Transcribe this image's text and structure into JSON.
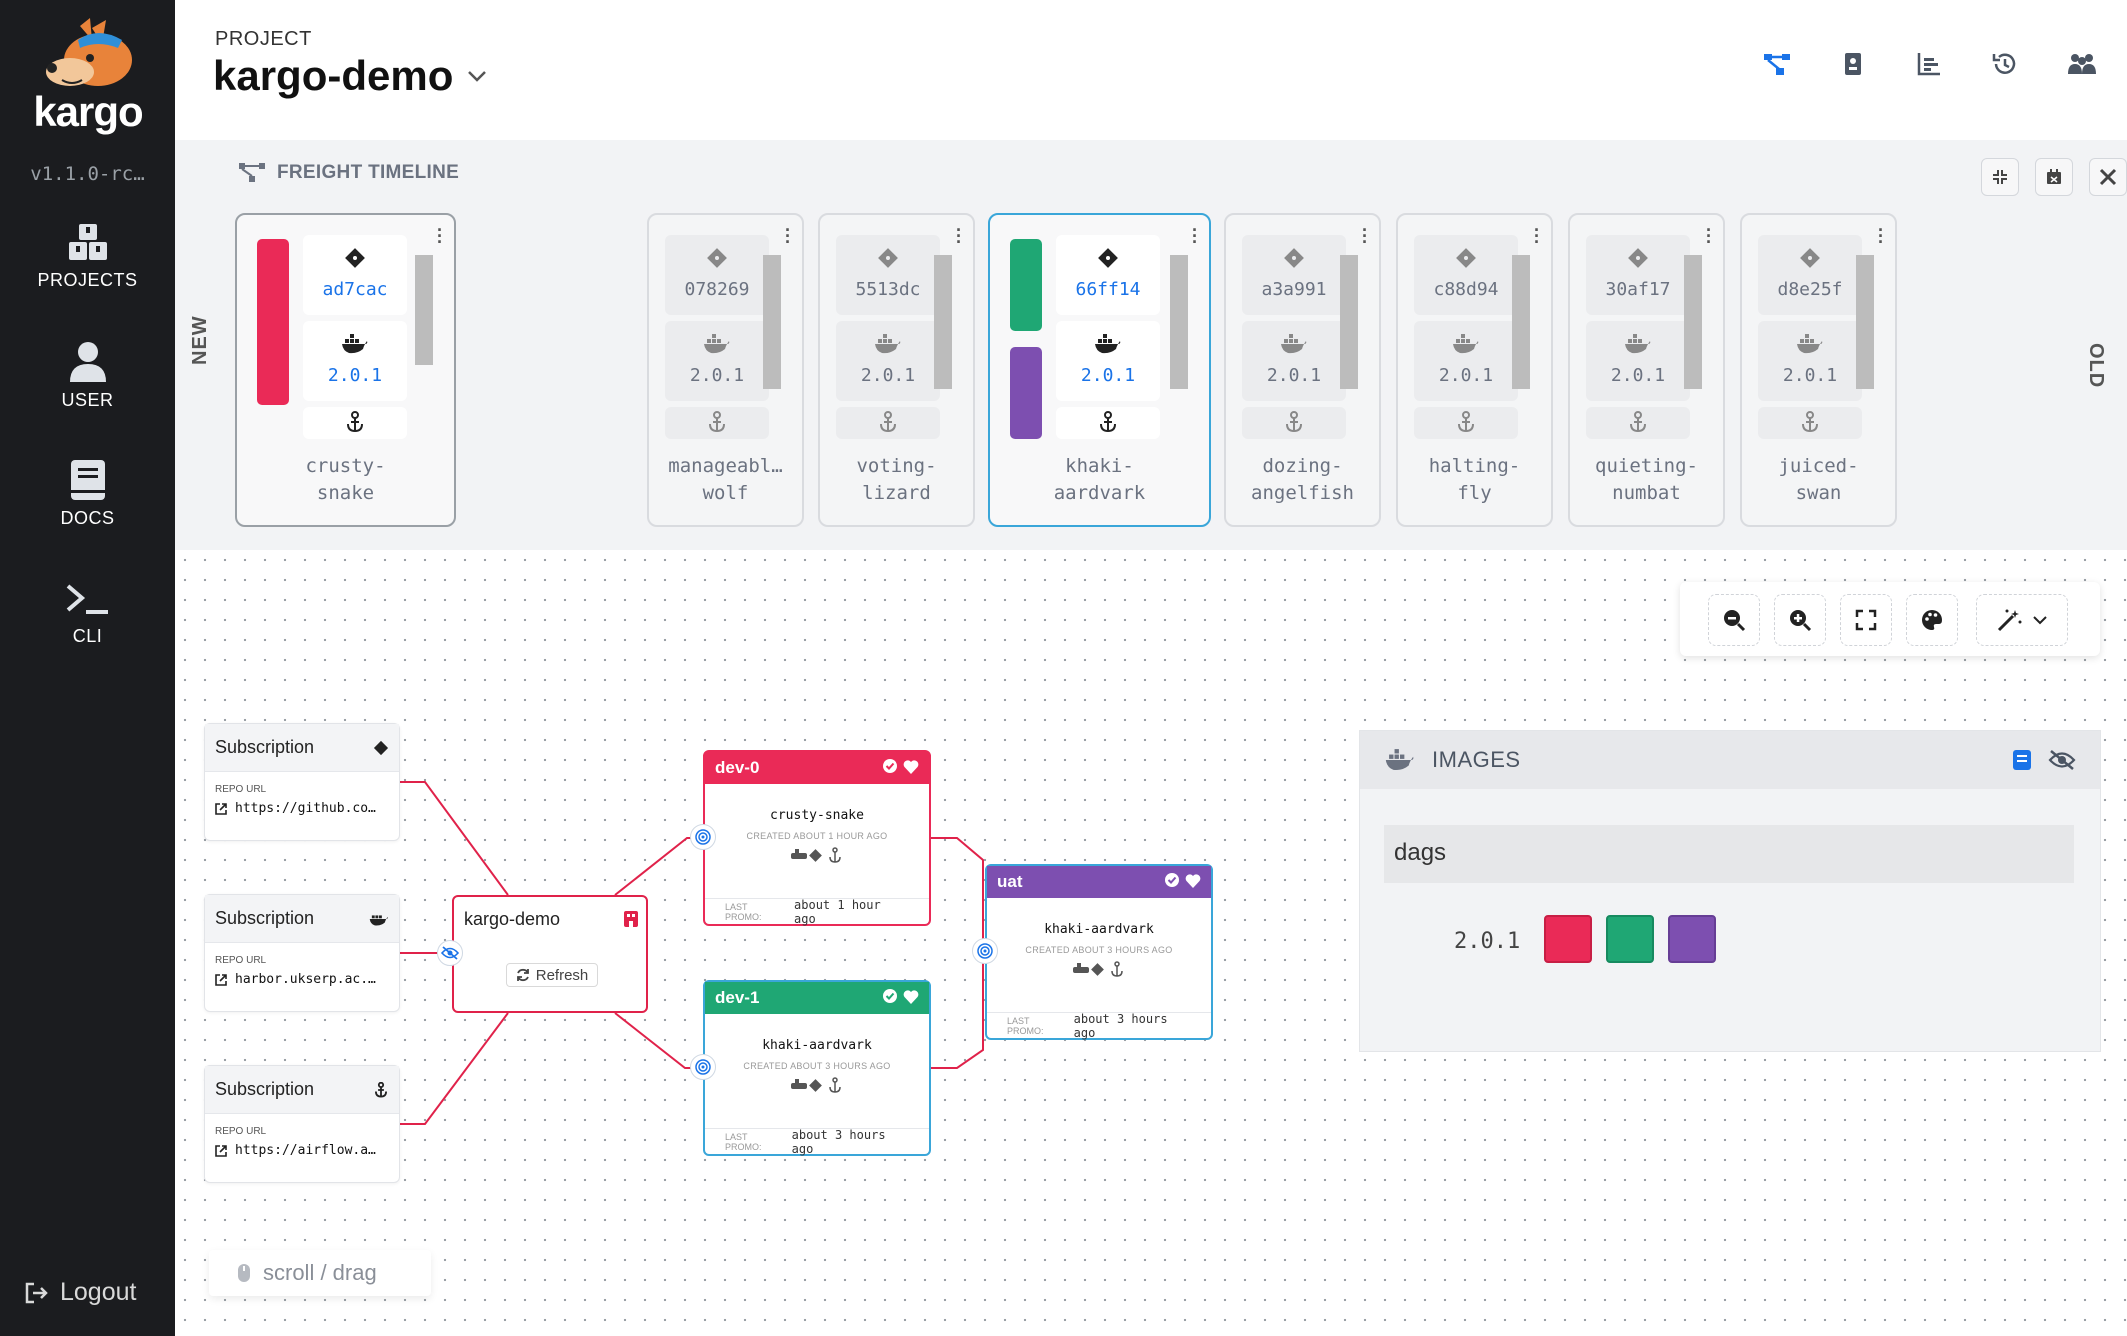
{
  "sidebar": {
    "logo_text": "kargo",
    "version": "v1.1.0-rc…",
    "items": [
      {
        "label": "PROJECTS",
        "icon": "projects-icon"
      },
      {
        "label": "USER",
        "icon": "user-icon"
      },
      {
        "label": "DOCS",
        "icon": "docs-icon"
      },
      {
        "label": "CLI",
        "icon": "cli-icon"
      }
    ],
    "logout": "Logout"
  },
  "header": {
    "project_label": "PROJECT",
    "project_name": "kargo-demo",
    "icons": [
      "pipeline-icon",
      "analysis-icon",
      "chart-icon",
      "history-icon",
      "roles-icon"
    ]
  },
  "timeline": {
    "title": "FREIGHT TIMELINE",
    "new_label": "NEW",
    "old_label": "OLD",
    "tools": [
      "collapse-icon",
      "calendar-icon",
      "tools-icon"
    ],
    "freight": [
      {
        "commit": "ad7cac",
        "image": "2.0.1",
        "name_line1": "crusty-",
        "name_line2": "snake"
      },
      {
        "commit": "078269",
        "image": "2.0.1",
        "name_line1": "manageabl…",
        "name_line2": "wolf"
      },
      {
        "commit": "5513dc",
        "image": "2.0.1",
        "name_line1": "voting-",
        "name_line2": "lizard"
      },
      {
        "commit": "66ff14",
        "image": "2.0.1",
        "name_line1": "khaki-",
        "name_line2": "aardvark"
      },
      {
        "commit": "a3a991",
        "image": "2.0.1",
        "name_line1": "dozing-",
        "name_line2": "angelfish"
      },
      {
        "commit": "c88d94",
        "image": "2.0.1",
        "name_line1": "halting-",
        "name_line2": "fly"
      },
      {
        "commit": "30af17",
        "image": "2.0.1",
        "name_line1": "quieting-",
        "name_line2": "numbat"
      },
      {
        "commit": "d8e25f",
        "image": "2.0.1",
        "name_line1": "juiced-",
        "name_line2": "swan"
      }
    ]
  },
  "graph": {
    "subscriptions": [
      {
        "title": "Subscription",
        "repo_label": "REPO URL",
        "url": "https://github.co…",
        "icon": "git-icon"
      },
      {
        "title": "Subscription",
        "repo_label": "REPO URL",
        "url": "harbor.ukserp.ac.…",
        "icon": "docker-icon"
      },
      {
        "title": "Subscription",
        "repo_label": "REPO URL",
        "url": "https://airflow.a…",
        "icon": "helm-icon"
      }
    ],
    "warehouse": {
      "title": "kargo-demo",
      "refresh": "Refresh"
    },
    "stages": [
      {
        "name": "dev-0",
        "freight": "crusty-snake",
        "created": "CREATED ABOUT 1 HOUR AGO",
        "last_promo_label": "LAST PROMO:",
        "last_promo": "about 1 hour ago",
        "color": "#ea2a57"
      },
      {
        "name": "dev-1",
        "freight": "khaki-aardvark",
        "created": "CREATED ABOUT 3 HOURS AGO",
        "last_promo_label": "LAST PROMO:",
        "last_promo": "about 3 hours ago",
        "color": "#1fa774"
      },
      {
        "name": "uat",
        "freight": "khaki-aardvark",
        "created": "CREATED ABOUT 3 HOURS AGO",
        "last_promo_label": "LAST PROMO:",
        "last_promo": "about 3 hours ago",
        "color": "#7d4fb0"
      }
    ],
    "images_panel": {
      "title": "IMAGES",
      "image_name": "dags",
      "version": "2.0.1",
      "swatches": [
        "#ea2a57",
        "#1fa774",
        "#7d4fb0"
      ]
    },
    "scroll_hint": "scroll / drag",
    "zoom_tools": [
      "zoom-out-icon",
      "zoom-in-icon",
      "fit-view-icon",
      "palette-icon",
      "magic-icon"
    ]
  }
}
